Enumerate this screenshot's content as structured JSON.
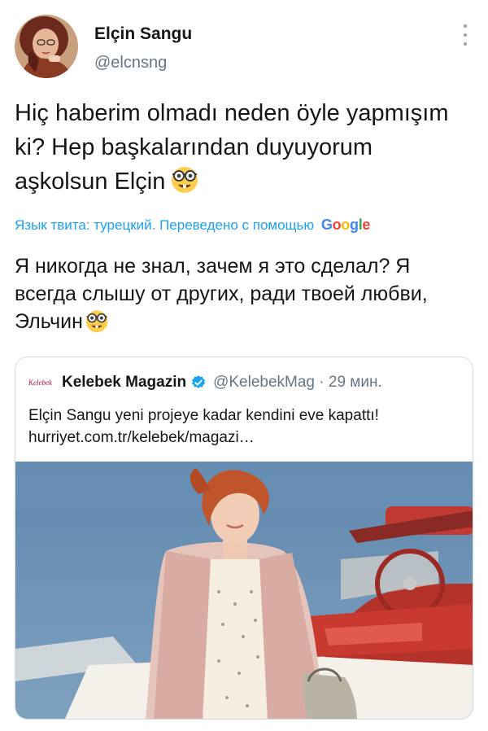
{
  "tweet": {
    "author": {
      "display_name": "Elçin Sangu",
      "handle": "@elcnsng"
    },
    "text": "Hiç haberim olmadı neden öyle yapmışım ki? Hep başkalarından duyuyorum aşkolsun Elçin",
    "emoji": "nerd-face",
    "translation_label": "Язык твита: турецкий. Переведено с помощью",
    "translation_provider": "Google",
    "translated_text": "Я никогда не знал, зачем я это сделал? Я всегда слышу от других, ради твоей любви, Эльчин"
  },
  "quoted_tweet": {
    "logo_text": "Kelebek",
    "name": "Kelebek Magazin",
    "handle_and_time": "@KelebekMag · 29 мин.",
    "text": "Elçin Sangu yeni projeye kadar kendini eve kapattı! hurriyet.com.tr/kelebek/magazi…",
    "image": "woman-in-pink-jacket-by-red-convertible-near-sea"
  },
  "colors": {
    "link_blue": "#1da1f2",
    "secondary_text": "#657786",
    "verified_blue": "#1da1f2",
    "card_border": "#d4dce2"
  }
}
